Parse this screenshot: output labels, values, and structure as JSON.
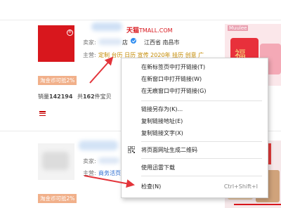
{
  "store1": {
    "brand_cn": "天猫",
    "brand_en": "TMALL.COM",
    "seller_label": "卖家:",
    "seller_suffix": "店",
    "location": "江西省 南昌市",
    "main_label": "主营:",
    "main_tags": "定制 台历 日历 宣传 2020年 挂历 创意 广",
    "badge": "淘金币可抵2%",
    "sales_label": "销量",
    "sales_value": "142194",
    "products_prefix": "共",
    "products_count": "162",
    "products_suffix": "件宝贝"
  },
  "store2": {
    "seller_label": "卖家:",
    "main_label": "主营:",
    "main_tags": "商务活页",
    "badge": "淘金币可抵2%"
  },
  "right_thumbnail": {
    "brand": "Muulee",
    "glyph": "福"
  },
  "context_menu": {
    "items": [
      {
        "label": "在新标签页中打开链接(T)",
        "shortcut": ""
      },
      {
        "label": "在新窗口中打开链接(W)",
        "shortcut": ""
      },
      {
        "label": "在无痕窗口中打开链接(G)",
        "shortcut": ""
      },
      {
        "label": "链接另存为(K)...",
        "shortcut": ""
      },
      {
        "label": "复制链接地址(E)",
        "shortcut": ""
      },
      {
        "label": "复制链接文字(X)",
        "shortcut": ""
      },
      {
        "label": "将页面网址生成二维码",
        "shortcut": "",
        "icon": "qr-code-icon"
      },
      {
        "label": "使用迅雷下载",
        "shortcut": ""
      },
      {
        "label": "检查(N)",
        "shortcut": "Ctrl+Shift+I"
      }
    ]
  },
  "colors": {
    "accent_red": "#d8171d",
    "badge_bg": "#f1b08a",
    "arrow": "#e3343a",
    "link_blue": "#2b6cd1"
  }
}
